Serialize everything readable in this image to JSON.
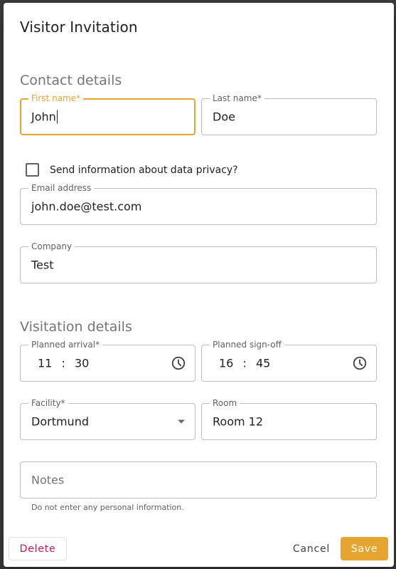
{
  "dialog": {
    "title": "Visitor Invitation",
    "contact_section": "Contact details",
    "visitation_section": "Visitation details"
  },
  "contact": {
    "first_name": {
      "label": "First name*",
      "value": "John"
    },
    "last_name": {
      "label": "Last name*",
      "value": "Doe"
    },
    "privacy_checkbox": {
      "label": "Send information about data privacy?",
      "checked": false
    },
    "email": {
      "label": "Email address",
      "value": "john.doe@test.com"
    },
    "company": {
      "label": "Company",
      "value": "Test"
    }
  },
  "visitation": {
    "planned_arrival": {
      "label": "Planned arrival*",
      "hour": "11",
      "separator": ":",
      "minute": "30"
    },
    "planned_signoff": {
      "label": "Planned sign-off",
      "hour": "16",
      "separator": ":",
      "minute": "45"
    },
    "facility": {
      "label": "Facility*",
      "value": "Dortmund"
    },
    "room": {
      "label": "Room",
      "value": "Room 12"
    },
    "notes": {
      "placeholder": "Notes",
      "hint": "Do not enter any personal information."
    }
  },
  "actions": {
    "delete": "Delete",
    "cancel": "Cancel",
    "save": "Save"
  },
  "colors": {
    "accent": "#e5a530",
    "danger": "#c2185b"
  },
  "icons": {
    "time": "clock-icon",
    "select": "dropdown-arrow-icon"
  }
}
